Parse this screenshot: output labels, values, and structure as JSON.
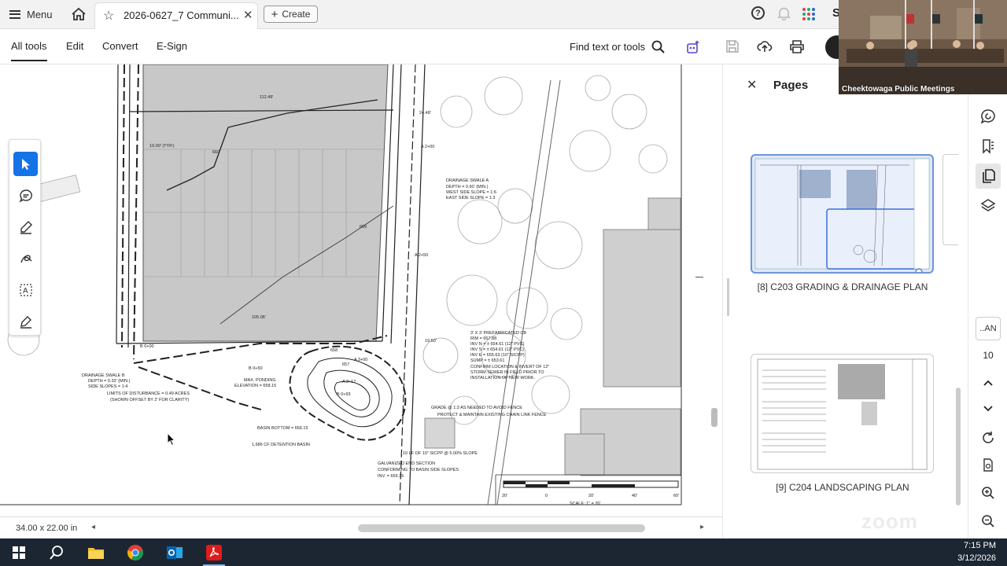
{
  "tabbar": {
    "menu_label": "Menu",
    "doc_tab_title": "2026-0627_7 Communi...",
    "create_label": "Create",
    "user_initial": "S"
  },
  "toolbar": {
    "items": [
      "All tools",
      "Edit",
      "Convert",
      "E-Sign"
    ],
    "find_label": "Find text or tools"
  },
  "drawing": {
    "labels": {
      "dim_top": "112.49'",
      "dim_typ": "19.00' (TYP.)",
      "dim_24": "24.48'",
      "dim_105": "105.06'",
      "dim_1946": "19.50'",
      "swale_a_title": "DRAINAGE SWALE A",
      "swale_a_depth": "DEPTH = 0.60' (MIN.)",
      "swale_a_west": "WEST SIDE SLOPE = 1:6",
      "swale_a_east": "EAST SIDE SLOPE = 1:3",
      "swale_b_title": "DRAINAGE SWALE B",
      "swale_b_depth": "DEPTH = 0.33' (MIN.)",
      "swale_b_slopes": "SIDE SLOPES = 1:4",
      "disturbance_1": "LIMITS OF DISTURBANCE = 0.49 ACRES",
      "disturbance_2": "(SHOWN OFFSET BY 2' FOR CLARITY)",
      "ponding_1": "MAX. PONDING",
      "ponding_2": "ELEVATION = 658.15",
      "basin_bottom": "BASIN BOTTOM = 656.15",
      "detention": "1,686 CF DETENTION BASIN",
      "cb_1": "3' X 3' PREFABRICATED CB",
      "cb_2": "RIM = 657.88",
      "cb_3": "INV N = ± 654.61 (12\" PVC)",
      "cb_4": "INV S = ± 654.61 (12\" PVC)",
      "cb_5": "INV E = 655.63 (10\" SICPP)",
      "cb_6": "SUMP = ± 653.61",
      "cb_7": "CONFIRM LOCATION & INVERT OF 12\"",
      "cb_8": "STORM SEWER IN FIELD PRIOR TO",
      "cb_9": "INSTALLATION OF NEW WORK.",
      "grade_note": "GRADE @ 1:3 AS NEEDED TO AVOID FENCE",
      "fence_note": "PROTECT & MAINTAIN EXISTING CHAIN LINK FENCE",
      "pipe_note": "10 LF OF 10\" SICPP @ 5.00% SLOPE",
      "end_1": "GALVANIZED END SECTION",
      "end_2": "CONFORMING TO BASIN SIDE SLOPES",
      "end_3": "INV. = 656.15",
      "sta_a0": "A 2+00",
      "sta_a1": "A 2+50",
      "sta_b0": "B 0+00",
      "sta_b1": "B 0+50",
      "sta_b2": "B 0+93",
      "sta_a3": "A 3+00",
      "sta_a4": "A 3+17",
      "c658": "658",
      "c657": "657",
      "c659": "659",
      "c660": "660",
      "scale_label": "SCALE: 1\" = 20'",
      "scale_ticks": [
        "20'",
        "0",
        "20'",
        "40'",
        "60'"
      ]
    }
  },
  "status": {
    "dimensions": "34.00 x 22.00 in"
  },
  "pages_panel": {
    "title": "Pages",
    "pages": [
      {
        "label": "[8] C203 GRADING & DRAINAGE PLAN",
        "selected": true
      },
      {
        "label": "[9] C204 LANDSCAPING PLAN",
        "selected": false
      }
    ]
  },
  "rail": {
    "zoom_box": "..AN",
    "page_number": "10"
  },
  "video": {
    "label": "Cheektowaga Public Meetings",
    "watermark": "zoom"
  },
  "taskbar": {
    "time": "7:15 PM",
    "date": "3/12/2026"
  },
  "colors": {
    "accent": "#1473e6",
    "selected_page_border": "#6f95d6",
    "taskbar": "#1c2632"
  }
}
